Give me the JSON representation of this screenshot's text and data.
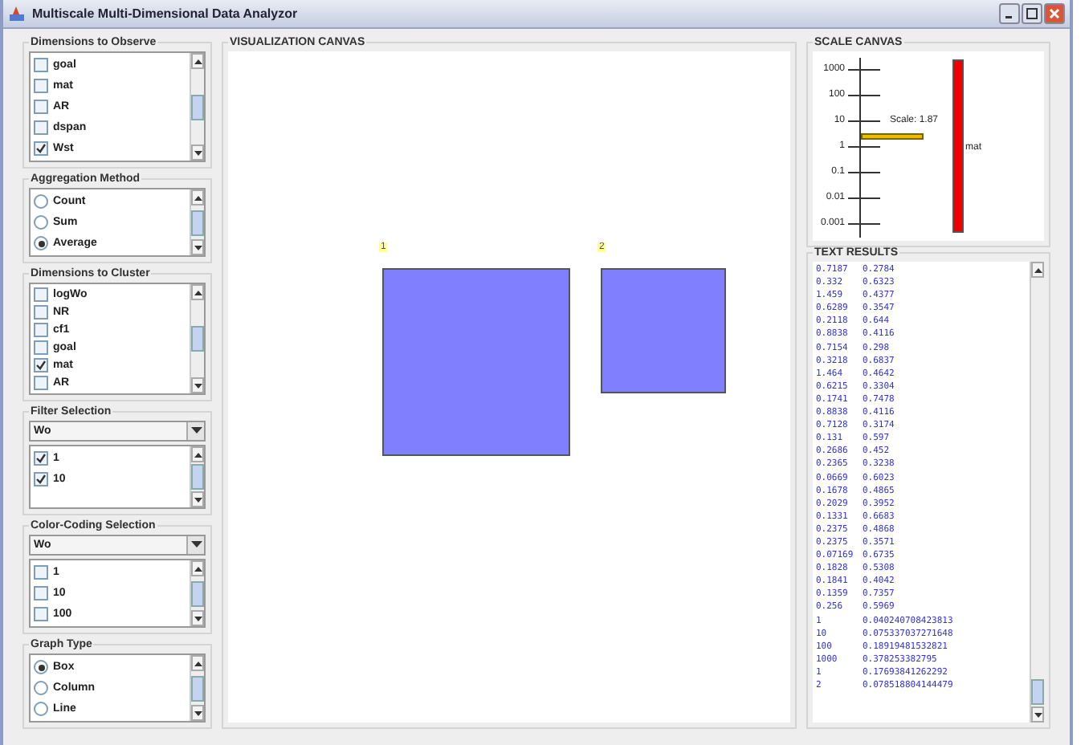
{
  "window": {
    "title": "Multiscale Multi-Dimensional Data Analyzor"
  },
  "left_panel": [
    {
      "title": "Dimensions to Observe",
      "kind": "checklist",
      "items": [
        {
          "label": "goal",
          "checked": false
        },
        {
          "label": "mat",
          "checked": false
        },
        {
          "label": "AR",
          "checked": false
        },
        {
          "label": "dspan",
          "checked": false
        },
        {
          "label": "Wst",
          "checked": true
        }
      ]
    },
    {
      "title": "Aggregation Method",
      "kind": "radiolist",
      "items": [
        {
          "label": "Count",
          "selected": false
        },
        {
          "label": "Sum",
          "selected": false
        },
        {
          "label": "Average",
          "selected": true
        }
      ]
    },
    {
      "title": "Dimensions to Cluster",
      "kind": "checklist",
      "items": [
        {
          "label": "logWo",
          "checked": false
        },
        {
          "label": "NR",
          "checked": false
        },
        {
          "label": "cf1",
          "checked": false
        },
        {
          "label": "goal",
          "checked": false
        },
        {
          "label": "mat",
          "checked": true
        },
        {
          "label": "AR",
          "checked": false
        }
      ]
    },
    {
      "title": "Filter Selection",
      "kind": "dropdown_checklist",
      "dropdown": "Wo",
      "items": [
        {
          "label": "1",
          "checked": true
        },
        {
          "label": "10",
          "checked": true
        }
      ]
    },
    {
      "title": "Color-Coding Selection",
      "kind": "dropdown_checklist",
      "dropdown": "Wo",
      "items": [
        {
          "label": "1",
          "checked": false
        },
        {
          "label": "10",
          "checked": false
        },
        {
          "label": "100",
          "checked": false
        }
      ]
    },
    {
      "title": "Graph Type",
      "kind": "radiolist",
      "items": [
        {
          "label": "Box",
          "selected": true
        },
        {
          "label": "Column",
          "selected": false
        },
        {
          "label": "Line",
          "selected": false
        }
      ]
    }
  ],
  "visualization": {
    "title": "VISUALIZATION CANVAS",
    "boxes": [
      {
        "label": "1"
      },
      {
        "label": "2"
      }
    ]
  },
  "scale_canvas": {
    "title": "SCALE CANVAS",
    "ticks": [
      "1000",
      "100",
      "10",
      "1",
      "0.1",
      "0.01",
      "0.001"
    ],
    "marker_label": "Scale: 1.87",
    "bar_label": "mat"
  },
  "text_results": {
    "title": "TEXT RESULTS",
    "rows": [
      [
        "0.7187",
        "0.2784"
      ],
      [
        "0.332",
        "0.6323"
      ],
      [
        "1.459",
        "0.4377"
      ],
      [
        "0.6289",
        "0.3547"
      ],
      [
        "0.2118",
        "0.644"
      ],
      [
        "0.8838",
        "0.4116"
      ],
      [
        "0.7154",
        "0.298"
      ],
      [
        "0.3218",
        "0.6837"
      ],
      [
        "1.464",
        "0.4642"
      ],
      [
        "0.6215",
        "0.3304"
      ],
      [
        "0.1741",
        "0.7478"
      ],
      [
        "0.8838",
        "0.4116"
      ],
      [
        "0.7128",
        "0.3174"
      ],
      [
        "0.131",
        "0.597"
      ],
      [
        "0.2686",
        "0.452"
      ],
      [
        "0.2365",
        "0.3238"
      ],
      [
        "0.0669",
        "0.6023"
      ],
      [
        "0.1678",
        "0.4865"
      ],
      [
        "0.2029",
        "0.3952"
      ],
      [
        "0.1331",
        "0.6683"
      ],
      [
        "0.2375",
        "0.4868"
      ],
      [
        "0.2375",
        "0.3571"
      ],
      [
        "0.07169",
        "0.6735"
      ],
      [
        "0.1828",
        "0.5308"
      ],
      [
        "0.1841",
        "0.4042"
      ],
      [
        "0.1359",
        "0.7357"
      ],
      [
        "0.256",
        "0.5969"
      ],
      [
        "1",
        "0.040240708423813"
      ],
      [
        "10",
        "0.075337037271648"
      ],
      [
        "100",
        "0.18919481532821"
      ],
      [
        "1000",
        "0.378253382795"
      ],
      [
        "1",
        "0.17693841262292"
      ],
      [
        "2",
        "0.078518804144479"
      ]
    ]
  }
}
